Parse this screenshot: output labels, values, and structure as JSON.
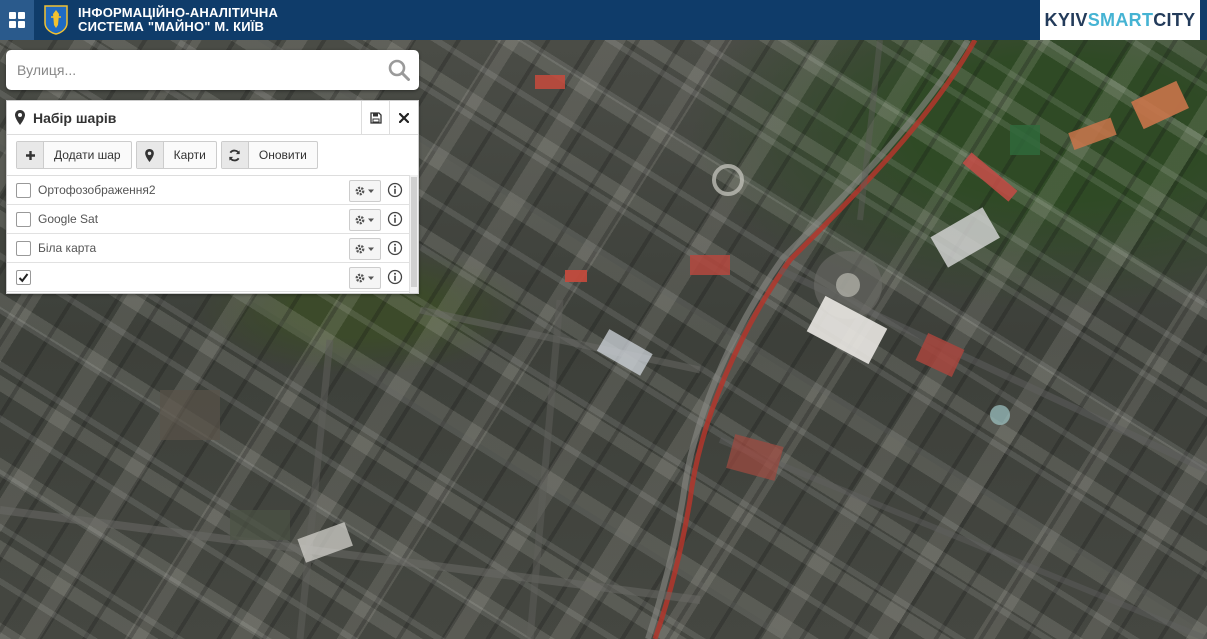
{
  "header": {
    "title_line1": "ІНФОРМАЦІЙНО-АНАЛІТИЧНА",
    "title_line2": "СИСТЕМА \"МАЙНО\" М. КИЇВ",
    "brand_part1": "KYIV",
    "brand_part2": "SMART",
    "brand_part3": "CITY",
    "brand_colors": {
      "dark": "#233b5a",
      "accent": "#45b3d3"
    },
    "bar_color": "#0f3c6a"
  },
  "search": {
    "placeholder": "Вулиця...",
    "value": "",
    "icon": "search-icon"
  },
  "panel": {
    "title": "Набір шарів",
    "icon": "map-marker-icon",
    "save_icon": "floppy-disk-icon",
    "close_icon": "close-icon",
    "toolbar": [
      {
        "label": "Додати шар",
        "icon": "plus-icon"
      },
      {
        "label": "Карти",
        "icon": "map-marker-icon"
      },
      {
        "label": "Оновити",
        "icon": "refresh-icon"
      }
    ],
    "layers": [
      {
        "name": "Ортофозображення2",
        "checked": false
      },
      {
        "name": "Google Sat",
        "checked": false
      },
      {
        "name": "Біла карта",
        "checked": false
      },
      {
        "name": "",
        "checked": true
      }
    ]
  }
}
